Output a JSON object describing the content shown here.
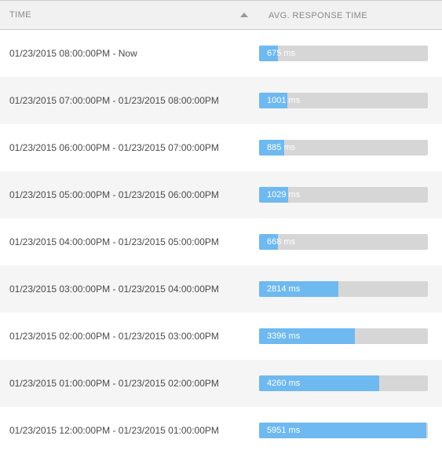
{
  "header": {
    "col_time": "TIME",
    "col_avg": "AVG. RESPONSE TIME"
  },
  "rows": [
    {
      "time_range": "01/23/2015 08:00:00PM - Now",
      "value_label": "675 ms"
    },
    {
      "time_range": "01/23/2015 07:00:00PM - 01/23/2015 08:00:00PM",
      "value_label": "1001 ms"
    },
    {
      "time_range": "01/23/2015 06:00:00PM - 01/23/2015 07:00:00PM",
      "value_label": "885 ms"
    },
    {
      "time_range": "01/23/2015 05:00:00PM - 01/23/2015 06:00:00PM",
      "value_label": "1029 ms"
    },
    {
      "time_range": "01/23/2015 04:00:00PM - 01/23/2015 05:00:00PM",
      "value_label": "668 ms"
    },
    {
      "time_range": "01/23/2015 03:00:00PM - 01/23/2015 04:00:00PM",
      "value_label": "2814 ms"
    },
    {
      "time_range": "01/23/2015 02:00:00PM - 01/23/2015 03:00:00PM",
      "value_label": "3396 ms"
    },
    {
      "time_range": "01/23/2015 01:00:00PM - 01/23/2015 02:00:00PM",
      "value_label": "4260 ms"
    },
    {
      "time_range": "01/23/2015 12:00:00PM - 01/23/2015 01:00:00PM",
      "value_label": "5951 ms"
    }
  ],
  "chart_data": {
    "type": "bar",
    "title": "",
    "xlabel": "TIME",
    "ylabel": "AVG. RESPONSE TIME",
    "categories": [
      "01/23/2015 08:00:00PM - Now",
      "01/23/2015 07:00:00PM - 01/23/2015 08:00:00PM",
      "01/23/2015 06:00:00PM - 01/23/2015 07:00:00PM",
      "01/23/2015 05:00:00PM - 01/23/2015 06:00:00PM",
      "01/23/2015 04:00:00PM - 01/23/2015 05:00:00PM",
      "01/23/2015 03:00:00PM - 01/23/2015 04:00:00PM",
      "01/23/2015 02:00:00PM - 01/23/2015 03:00:00PM",
      "01/23/2015 01:00:00PM - 01/23/2015 02:00:00PM",
      "01/23/2015 12:00:00PM - 01/23/2015 01:00:00PM"
    ],
    "values": [
      675,
      1001,
      885,
      1029,
      668,
      2814,
      3396,
      4260,
      5951
    ],
    "unit": "ms",
    "ylim": [
      0,
      6000
    ]
  },
  "colors": {
    "bar_fill": "#6eb9ef",
    "bar_track": "#d6d6d6"
  }
}
